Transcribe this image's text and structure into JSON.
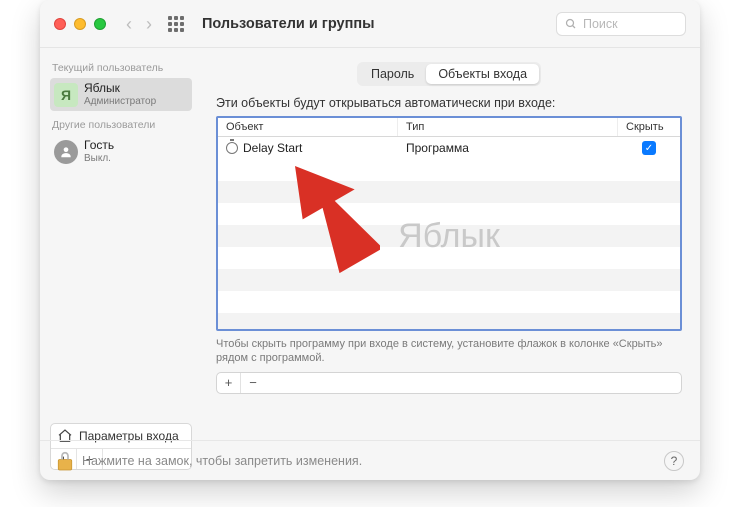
{
  "header": {
    "title": "Пользователи и группы",
    "search_placeholder": "Поиск"
  },
  "sidebar": {
    "current_label": "Текущий пользователь",
    "other_label": "Другие пользователи",
    "current_user": {
      "name": "Яблык",
      "role": "Администратор",
      "initial": "Я"
    },
    "guest": {
      "name": "Гость",
      "role": "Выкл."
    },
    "login_options": "Параметры входа",
    "plus": "+",
    "minus": "−"
  },
  "main": {
    "tabs": {
      "password": "Пароль",
      "login_items": "Объекты входа"
    },
    "description": "Эти объекты будут открываться автоматически при входе:",
    "columns": {
      "object": "Объект",
      "type": "Тип",
      "hide": "Скрыть"
    },
    "items": [
      {
        "name": "Delay Start",
        "type": "Программа",
        "hidden": true
      }
    ],
    "watermark": "Яблык",
    "hint": "Чтобы скрыть программу при входе в систему, установите флажок в колонке «Скрыть» рядом с программой.",
    "plus": "+",
    "minus": "−"
  },
  "lock": {
    "text": "Нажмите на замок, чтобы запретить изменения.",
    "help": "?"
  }
}
